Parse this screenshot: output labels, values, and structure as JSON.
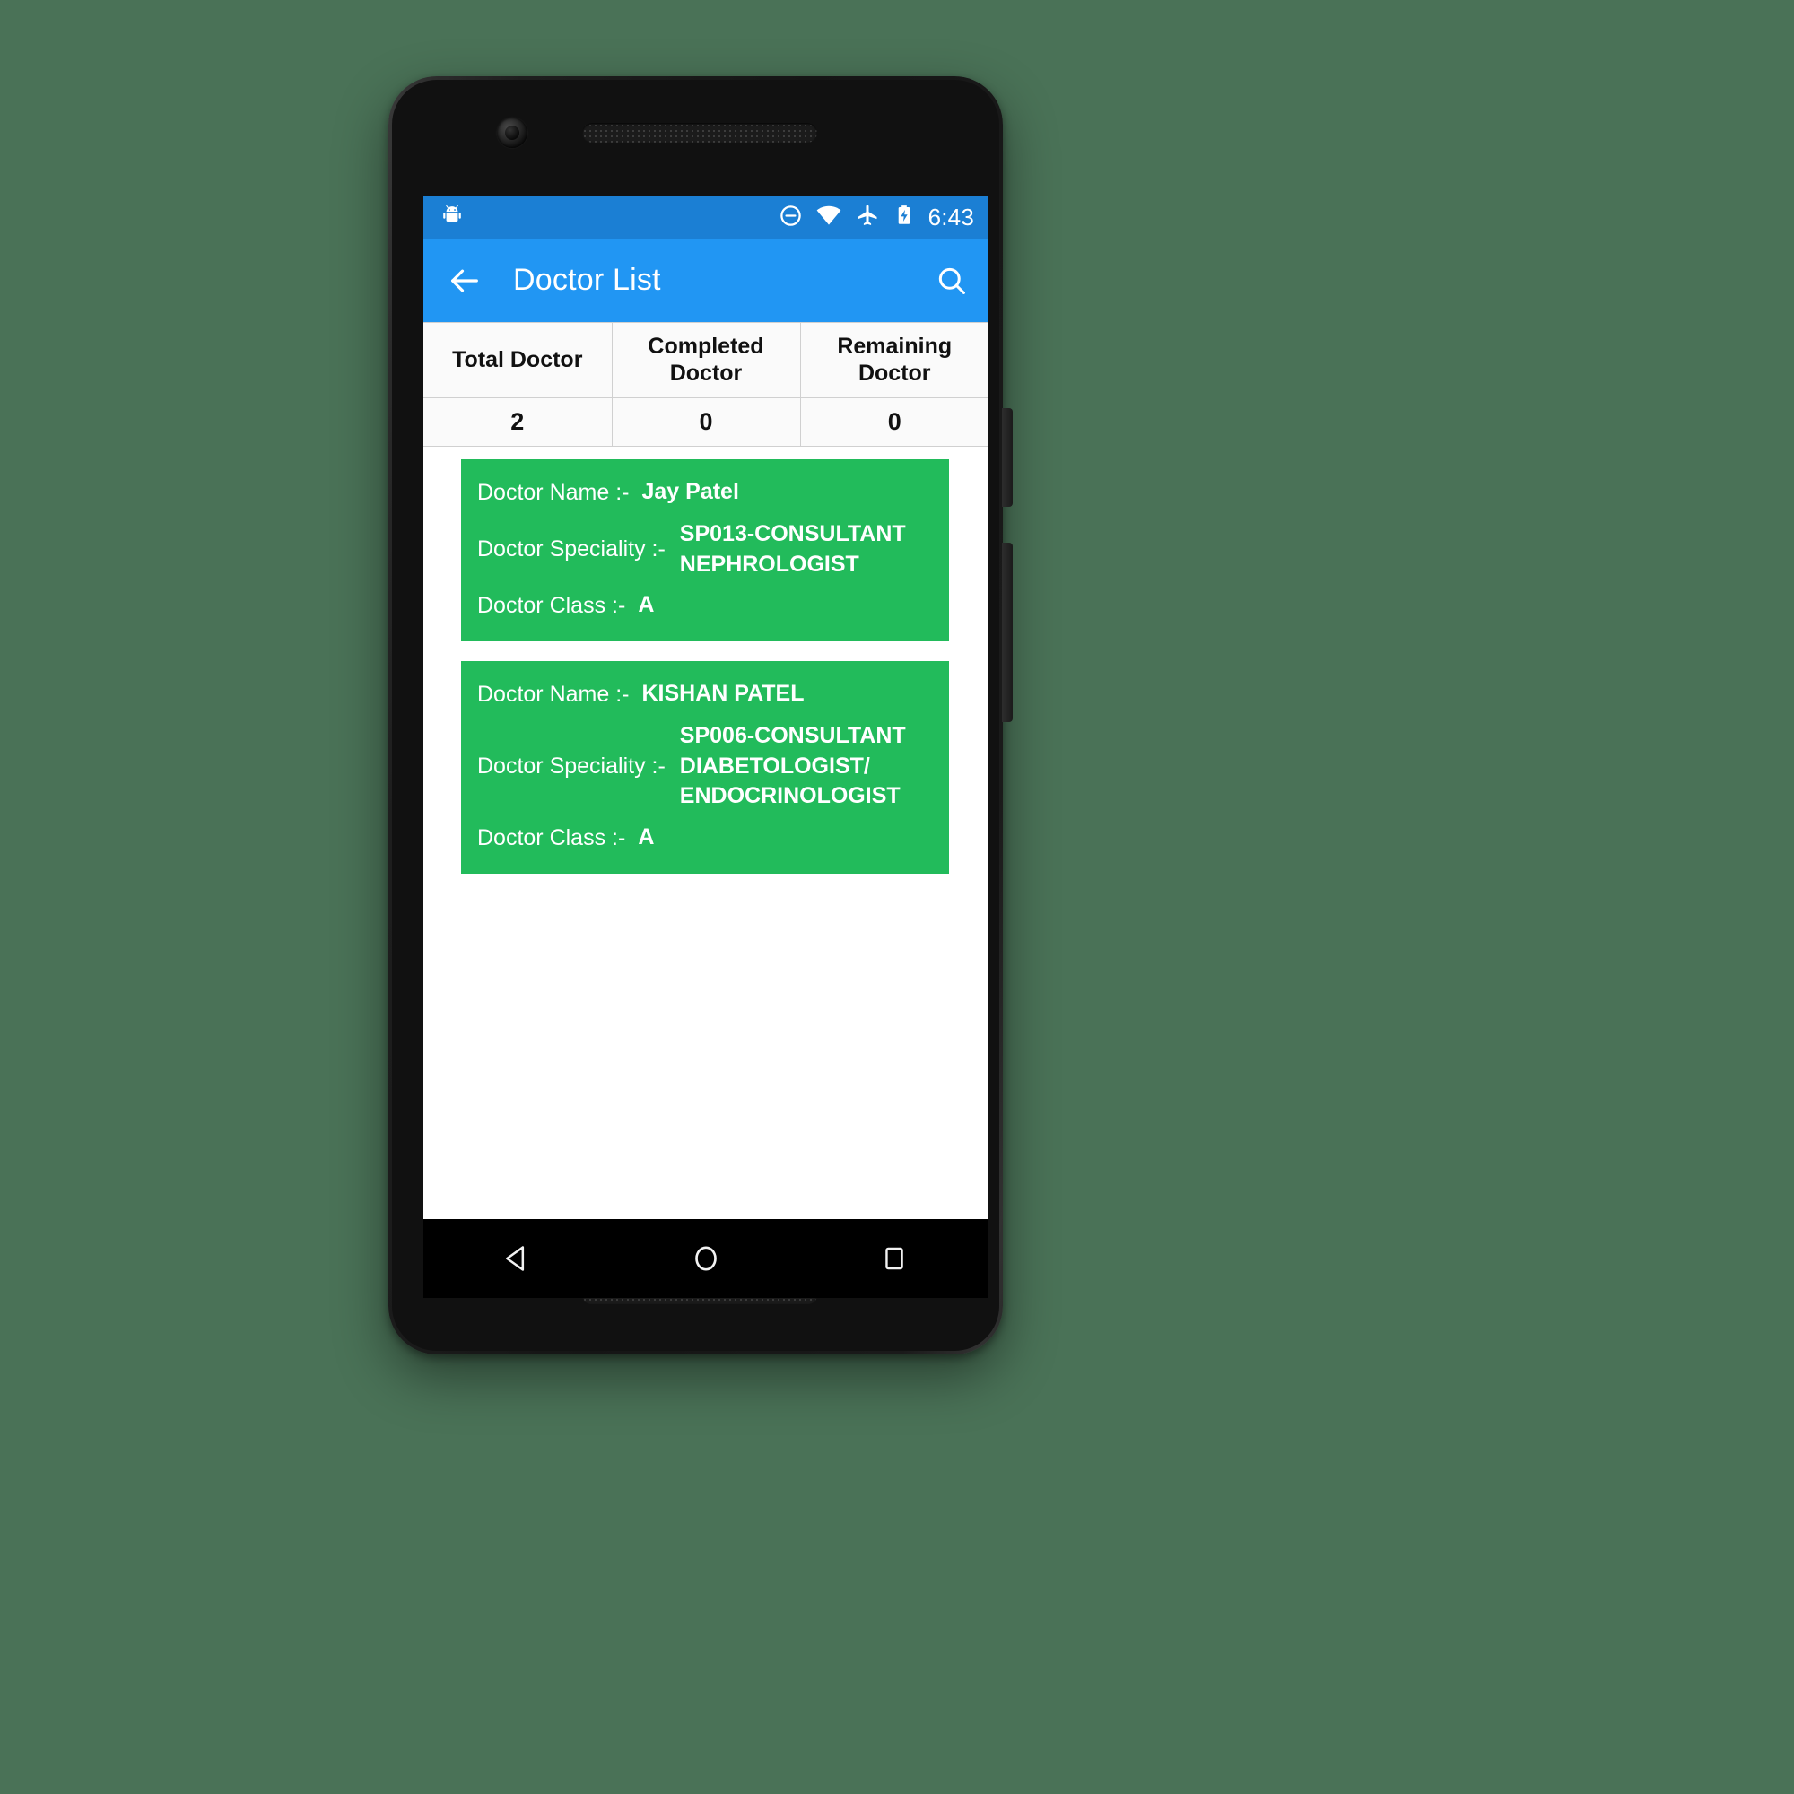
{
  "status_bar": {
    "time": "6:43",
    "icons": [
      "app-notification-icon",
      "do-not-disturb-icon",
      "wifi-icon",
      "airplane-mode-icon",
      "battery-charging-icon"
    ],
    "background_color": "#1b7fd4"
  },
  "app_bar": {
    "title": "Doctor List",
    "back_icon": "arrow-back-icon",
    "search_icon": "search-icon",
    "background_color": "#2196f3"
  },
  "summary_table": {
    "headers": [
      "Total Doctor",
      "Completed Doctor",
      "Remaining Doctor"
    ],
    "values": [
      "2",
      "0",
      "0"
    ]
  },
  "doctor_list": {
    "card_color": "#22bb5b",
    "labels": {
      "name": "Doctor Name :-",
      "speciality": "Doctor Speciality :-",
      "doctor_class": "Doctor Class :-"
    },
    "items": [
      {
        "name": "Jay Patel",
        "speciality": "SP013-CONSULTANT NEPHROLOGIST",
        "doctor_class": "A"
      },
      {
        "name": "KISHAN PATEL",
        "speciality": "SP006-CONSULTANT DIABETOLOGIST/ ENDOCRINOLOGIST",
        "doctor_class": "A"
      }
    ]
  },
  "nav_bar": {
    "back": "nav-back-icon",
    "home": "nav-home-icon",
    "recents": "nav-recents-icon"
  }
}
